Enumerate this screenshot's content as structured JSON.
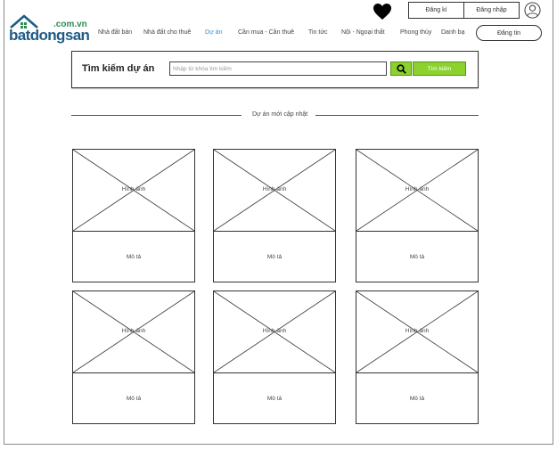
{
  "logo": {
    "suffix": ".com.vn",
    "brand": "batdongsan"
  },
  "nav": {
    "items": [
      {
        "label": "Nhà đất bán",
        "active": false
      },
      {
        "label": "Nhà đất cho thuê",
        "active": false
      },
      {
        "label": "Dự án",
        "active": true
      },
      {
        "label": "Cần mua - Cần thuê",
        "active": false
      },
      {
        "label": "Tin tức",
        "active": false
      },
      {
        "label": "Nội - Ngoại thất",
        "active": false
      },
      {
        "label": "Phong thủy",
        "active": false
      },
      {
        "label": "Danh bạ",
        "active": false
      }
    ],
    "active_color": "#2f8fd8"
  },
  "header": {
    "favorite_icon": "heart-icon",
    "register_label": "Đăng kí",
    "login_label": "Đăng nhập",
    "user_icon": "user-icon",
    "post_label": "Đăng tin"
  },
  "search": {
    "title": "Tìm kiếm dự án",
    "placeholder": "Nhập từ khóa tìm kiếm",
    "value": "",
    "icon": "search-icon",
    "button_label": "Tìm kiếm",
    "accent_color": "#8bd22e"
  },
  "section": {
    "title": "Dự án mới cập nhật"
  },
  "cards": [
    {
      "image_label": "Hình ảnh",
      "desc_label": "Mô tả"
    },
    {
      "image_label": "Hình ảnh",
      "desc_label": "Mô tả"
    },
    {
      "image_label": "Hình ảnh",
      "desc_label": "Mô tả"
    },
    {
      "image_label": "Hình ảnh",
      "desc_label": "Mô tả"
    },
    {
      "image_label": "Hình ảnh",
      "desc_label": "Mô tả"
    },
    {
      "image_label": "Hình ảnh",
      "desc_label": "Mô tả"
    }
  ]
}
